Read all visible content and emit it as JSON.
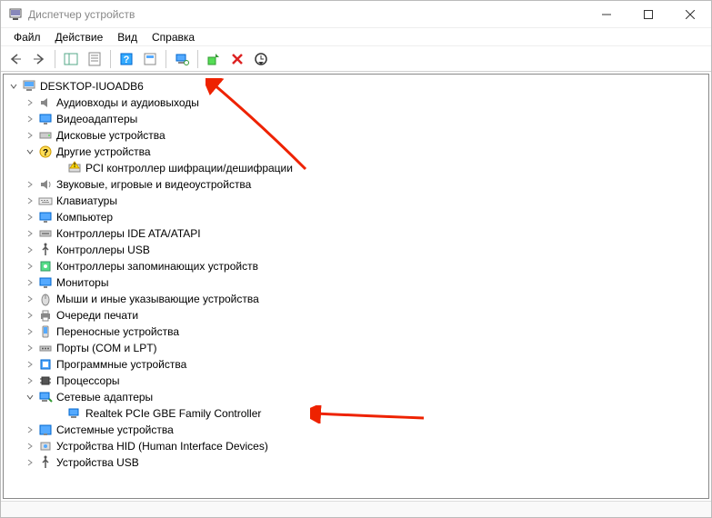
{
  "window": {
    "title": "Диспетчер устройств"
  },
  "menu": {
    "file": "Файл",
    "action": "Действие",
    "view": "Вид",
    "help": "Справка"
  },
  "tree": {
    "root": "DESKTOP-IUOADB6",
    "nodes": [
      {
        "label": "Аудиовходы и аудиовыходы",
        "icon": "audio",
        "expanded": false
      },
      {
        "label": "Видеоадаптеры",
        "icon": "display",
        "expanded": false
      },
      {
        "label": "Дисковые устройства",
        "icon": "disk",
        "expanded": false
      },
      {
        "label": "Другие устройства",
        "icon": "unknown",
        "expanded": true,
        "children": [
          {
            "label": "PCI контроллер шифрации/дешифрации",
            "icon": "warning"
          }
        ]
      },
      {
        "label": "Звуковые, игровые и видеоустройства",
        "icon": "sound",
        "expanded": false
      },
      {
        "label": "Клавиатуры",
        "icon": "keyboard",
        "expanded": false
      },
      {
        "label": "Компьютер",
        "icon": "computer",
        "expanded": false
      },
      {
        "label": "Контроллеры IDE ATA/ATAPI",
        "icon": "ide",
        "expanded": false
      },
      {
        "label": "Контроллеры USB",
        "icon": "usb",
        "expanded": false
      },
      {
        "label": "Контроллеры запоминающих устройств",
        "icon": "storage",
        "expanded": false
      },
      {
        "label": "Мониторы",
        "icon": "monitor",
        "expanded": false
      },
      {
        "label": "Мыши и иные указывающие устройства",
        "icon": "mouse",
        "expanded": false
      },
      {
        "label": "Очереди печати",
        "icon": "printer",
        "expanded": false
      },
      {
        "label": "Переносные устройства",
        "icon": "portable",
        "expanded": false
      },
      {
        "label": "Порты (COM и LPT)",
        "icon": "port",
        "expanded": false
      },
      {
        "label": "Программные устройства",
        "icon": "software",
        "expanded": false
      },
      {
        "label": "Процессоры",
        "icon": "cpu",
        "expanded": false
      },
      {
        "label": "Сетевые адаптеры",
        "icon": "network",
        "expanded": true,
        "children": [
          {
            "label": "Realtek PCIe GBE Family Controller",
            "icon": "netcard"
          }
        ]
      },
      {
        "label": "Системные устройства",
        "icon": "system",
        "expanded": false
      },
      {
        "label": "Устройства HID (Human Interface Devices)",
        "icon": "hid",
        "expanded": false
      },
      {
        "label": "Устройства USB",
        "icon": "usbdev",
        "expanded": false
      }
    ]
  }
}
